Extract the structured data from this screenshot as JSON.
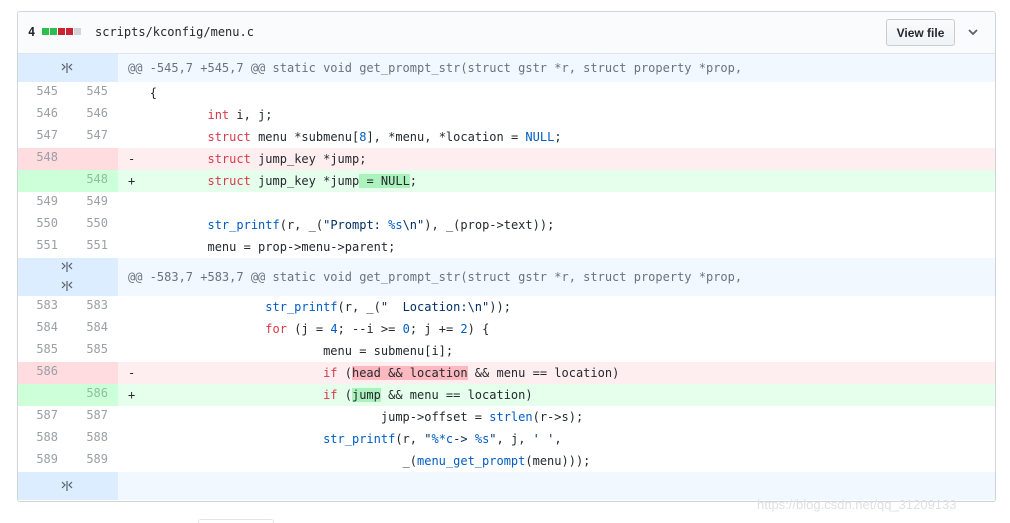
{
  "file": {
    "change_count": "4",
    "path": "scripts/kconfig/menu.c",
    "view_file_label": "View file",
    "diffstat_colors": [
      "#2cbe4e",
      "#2cbe4e",
      "#cb2431",
      "#cb2431",
      "#d1d5da"
    ]
  },
  "hunks": [
    {
      "header": "@@ -545,7 +545,7 @@ static void get_prompt_str(struct gstr *r, struct property *prop,"
    },
    {
      "header": "@@ -583,7 +583,7 @@ static void get_prompt_str(struct gstr *r, struct property *prop,"
    }
  ],
  "lines": [
    {
      "old": "545",
      "new": "545",
      "marker": " ",
      "text": "{"
    },
    {
      "old": "546",
      "new": "546",
      "marker": " ",
      "text": "int i, j;"
    },
    {
      "old": "547",
      "new": "547",
      "marker": " ",
      "text": "struct menu *submenu[8], *menu, *location = NULL;"
    },
    {
      "old": "548",
      "new": "",
      "marker": "-",
      "text": "struct jump_key *jump;"
    },
    {
      "old": "",
      "new": "548",
      "marker": "+",
      "text": "struct jump_key *jump = NULL;"
    },
    {
      "old": "549",
      "new": "549",
      "marker": " ",
      "text": ""
    },
    {
      "old": "550",
      "new": "550",
      "marker": " ",
      "text": "str_printf(r, _(\"Prompt: %s\\n\"), _(prop->text));"
    },
    {
      "old": "551",
      "new": "551",
      "marker": " ",
      "text": "menu = prop->menu->parent;"
    },
    {
      "old": "583",
      "new": "583",
      "marker": " ",
      "text": "str_printf(r, _(\"  Location:\\n\"));"
    },
    {
      "old": "584",
      "new": "584",
      "marker": " ",
      "text": "for (j = 4; --i >= 0; j += 2) {"
    },
    {
      "old": "585",
      "new": "585",
      "marker": " ",
      "text": "menu = submenu[i];"
    },
    {
      "old": "586",
      "new": "",
      "marker": "-",
      "text": "if (head && location && menu == location)"
    },
    {
      "old": "",
      "new": "586",
      "marker": "+",
      "text": "if (jump && menu == location)"
    },
    {
      "old": "587",
      "new": "587",
      "marker": " ",
      "text": "jump->offset = strlen(r->s);"
    },
    {
      "old": "588",
      "new": "588",
      "marker": " ",
      "text": "str_printf(r, \"%*c-> %s\", j, ' ',"
    },
    {
      "old": "589",
      "new": "589",
      "marker": " ",
      "text": "_(menu_get_prompt(menu)));"
    }
  ],
  "watermark": "https://blog.csdn.net/qq_31209133",
  "icons": {
    "expand": "unfold-icon",
    "chevron": "chevron-down-icon"
  }
}
